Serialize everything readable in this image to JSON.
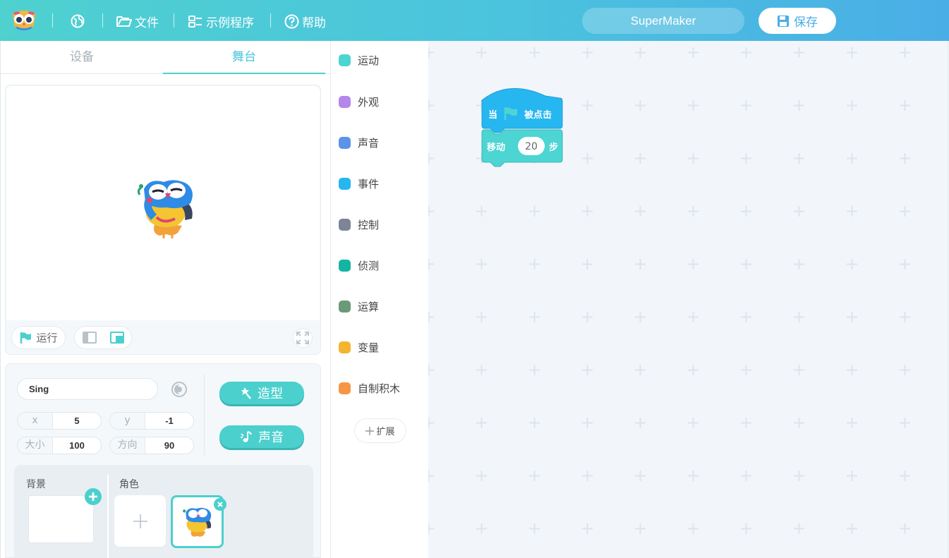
{
  "topbar": {
    "file_label": "文件",
    "examples_label": "示例程序",
    "help_label": "帮助",
    "project_name": "SuperMaker",
    "save_label": "保存"
  },
  "tabs": {
    "device_label": "设备",
    "stage_label": "舞台"
  },
  "stage_controls": {
    "run_label": "运行"
  },
  "sprite": {
    "name": "Sing",
    "x_label": "x",
    "x_value": "5",
    "y_label": "y",
    "y_value": "-1",
    "size_label": "大小",
    "size_value": "100",
    "direction_label": "方向",
    "direction_value": "90",
    "costume_label": "造型",
    "sound_label": "声音"
  },
  "assets": {
    "backdrop_label": "背景",
    "sprite_label": "角色"
  },
  "categories": [
    {
      "label": "运动",
      "color": "#4cd5d2"
    },
    {
      "label": "外观",
      "color": "#b587ec"
    },
    {
      "label": "声音",
      "color": "#5b93e8"
    },
    {
      "label": "事件",
      "color": "#26b6f0"
    },
    {
      "label": "控制",
      "color": "#7d8497"
    },
    {
      "label": "侦测",
      "color": "#15b4a2"
    },
    {
      "label": "运算",
      "color": "#6b9a7a"
    },
    {
      "label": "变量",
      "color": "#f3b52f"
    },
    {
      "label": "自制积木",
      "color": "#f79547"
    }
  ],
  "extension_label": "扩展",
  "blocks": {
    "hat_prefix": "当",
    "hat_suffix": "被点击",
    "move_prefix": "移动",
    "move_value": "20",
    "move_suffix": "步"
  },
  "colors": {
    "accent": "#4bd0cd",
    "event_block": "#26b6f0",
    "motion_block": "#4cd5d2"
  }
}
